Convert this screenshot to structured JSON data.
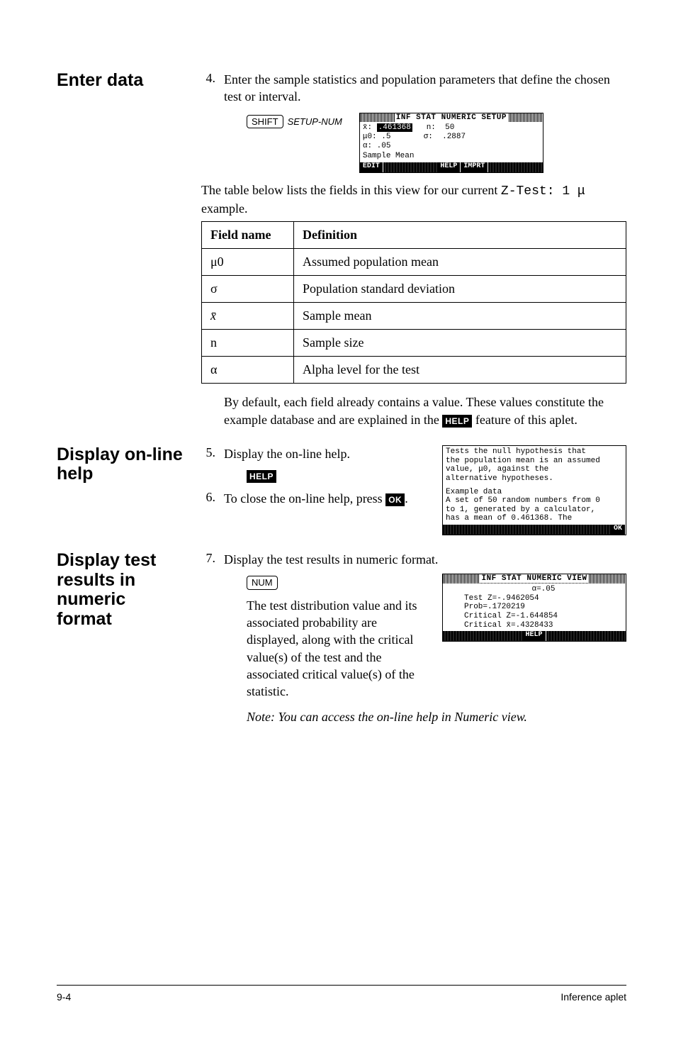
{
  "section1": {
    "heading": "Enter data",
    "step_num": "4.",
    "intro": "Enter the sample statistics and population parameters that define the chosen test or interval.",
    "key1": "SHIFT",
    "key2": "SETUP-NUM",
    "screen": {
      "title": "INF STAT NUMERIC SETUP",
      "line_xbar_lbl": "x̄:",
      "line_xbar_val": ".461368",
      "line_n_lbl": "n:",
      "line_n_val": "50",
      "line_mu0_lbl": "μ0:",
      "line_mu0_val": ".5",
      "line_sigma_lbl": "σ:",
      "line_sigma_val": ".2887",
      "line_alpha_lbl": "α:",
      "line_alpha_val": ".05",
      "subhead": "Sample Mean",
      "m1": "EDIT",
      "m2": "HELP",
      "m3": "IMPRT"
    },
    "after_pre": "The table below lists the fields in this view for our current ",
    "after_code": "Z-Test: 1 μ",
    "after_post": " example.",
    "table": {
      "h1": "Field name",
      "h2": "Definition",
      "rows": [
        {
          "name": "μ0",
          "def": "Assumed population mean"
        },
        {
          "name": "σ",
          "def": "Population standard deviation"
        },
        {
          "name": "x̄",
          "def": "Sample mean",
          "style": "italic"
        },
        {
          "name": "n",
          "def": "Sample size"
        },
        {
          "name": "α",
          "def": "Alpha level for the test"
        }
      ]
    }
  },
  "defaults_pre": "By default, each field already contains a value. These values constitute the example database and are explained in the ",
  "defaults_key": "HELP",
  "defaults_post": " feature of this aplet.",
  "section2": {
    "heading": "Display on-line help",
    "step5_num": "5.",
    "step5_text": "Display the on-line help.",
    "step5_key": "HELP",
    "step6_num": "6.",
    "step6_text_pre": "To close the on-line help, press ",
    "step6_key": "OK",
    "step6_text_post": ".",
    "screen": {
      "l1": "Tests the null hypothesis that",
      "l2": "the population mean is an assumed",
      "l3": "value, μ0, against the",
      "l4": "alternative hypotheses.",
      "l5": "Example data",
      "l6": "A set of 50 random numbers from 0",
      "l7": "to 1, generated by a calculator,",
      "l8": "has a mean of 0.461368. The",
      "m1": "OK"
    }
  },
  "section3": {
    "heading": "Display test results in numeric format",
    "step7_num": "7.",
    "step7_text": "Display the test results in numeric format.",
    "key": "NUM",
    "body": "The test distribution value and its associated probability are displayed, along with the critical value(s) of the test and the associated critical value(s) of the statistic.",
    "note": "Note: You can access the on-line help in Numeric view.",
    "screen": {
      "title": "INF STAT NUMERIC VIEW",
      "l1": "α=.05",
      "l2": "Test Z=-.9462054",
      "l3": "Prob=.1720219",
      "l4": "Critical Z=-1.644854",
      "l5": "Critical x̄=.4328433",
      "m1": "HELP"
    }
  },
  "footer": {
    "left": "9-4",
    "right": "Inference aplet"
  }
}
